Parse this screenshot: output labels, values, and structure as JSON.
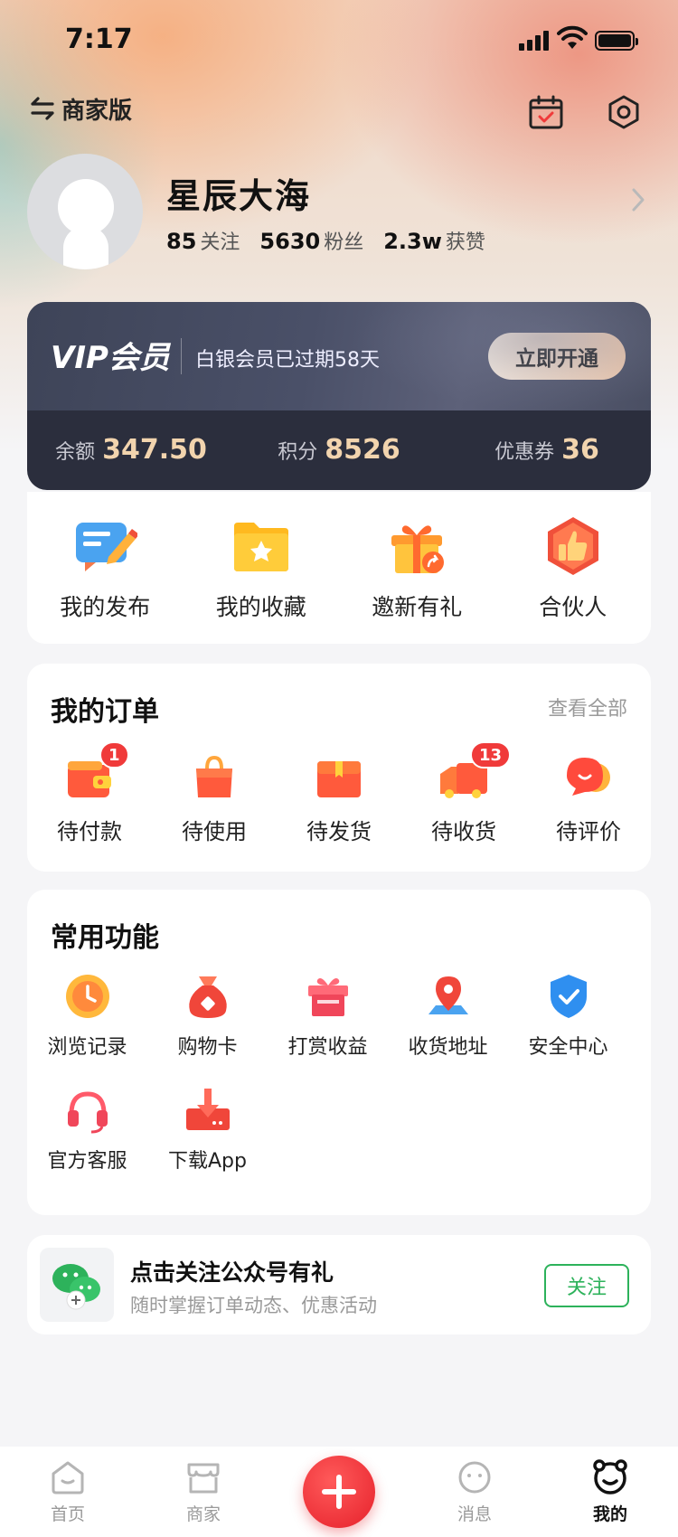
{
  "status_bar": {
    "time": "7:17"
  },
  "header": {
    "merchant_switch_label": "商家版"
  },
  "profile": {
    "name": "星辰大海",
    "stats": [
      {
        "value": "85",
        "label": "关注"
      },
      {
        "value": "5630",
        "label": "粉丝"
      },
      {
        "value": "2.3w",
        "label": "获赞"
      }
    ]
  },
  "vip": {
    "logo": "VIP会员",
    "expire_text": "白银会员已过期58天",
    "open_button": "立即开通",
    "assets": [
      {
        "label": "余额",
        "value": "347.50"
      },
      {
        "label": "积分",
        "value": "8526"
      },
      {
        "label": "优惠券",
        "value": "36"
      }
    ]
  },
  "shortcuts": [
    {
      "label": "我的发布",
      "icon": "publish-icon"
    },
    {
      "label": "我的收藏",
      "icon": "favorites-folder-icon"
    },
    {
      "label": "邀新有礼",
      "icon": "gift-share-icon"
    },
    {
      "label": "合伙人",
      "icon": "thumbs-up-icon"
    }
  ],
  "orders": {
    "title": "我的订单",
    "view_all": "查看全部",
    "items": [
      {
        "label": "待付款",
        "badge": "1",
        "icon": "wallet-icon"
      },
      {
        "label": "待使用",
        "badge": "",
        "icon": "shopping-bag-icon"
      },
      {
        "label": "待发货",
        "badge": "",
        "icon": "package-box-icon"
      },
      {
        "label": "待收货",
        "badge": "13",
        "icon": "delivery-truck-icon"
      },
      {
        "label": "待评价",
        "badge": "",
        "icon": "comment-bubble-icon"
      }
    ]
  },
  "functions": {
    "title": "常用功能",
    "items": [
      {
        "label": "浏览记录",
        "icon": "clock-icon"
      },
      {
        "label": "购物卡",
        "icon": "money-bag-icon"
      },
      {
        "label": "打赏收益",
        "icon": "gift-box-icon"
      },
      {
        "label": "收货地址",
        "icon": "location-pin-icon"
      },
      {
        "label": "安全中心",
        "icon": "shield-check-icon"
      },
      {
        "label": "官方客服",
        "icon": "headset-icon"
      },
      {
        "label": "下载App",
        "icon": "download-icon"
      }
    ]
  },
  "follow": {
    "title": "点击关注公众号有礼",
    "subtitle": "随时掌握订单动态、优惠活动",
    "button": "关注"
  },
  "tab_bar": {
    "tabs": [
      {
        "label": "首页",
        "icon": "home-icon"
      },
      {
        "label": "商家",
        "icon": "shop-icon"
      },
      {
        "label": "",
        "icon": "plus-icon"
      },
      {
        "label": "消息",
        "icon": "message-icon"
      },
      {
        "label": "我的",
        "icon": "profile-face-icon"
      }
    ],
    "active": "我的"
  },
  "colors": {
    "accent_red": "#f03a3a",
    "vip_gold": "#f2d4ae",
    "vip_card": "#2b2e3d",
    "follow_green": "#2db25b"
  }
}
